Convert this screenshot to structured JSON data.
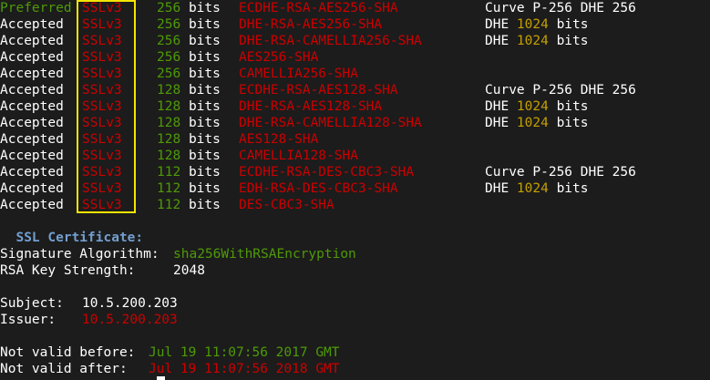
{
  "colors": {
    "background": "#1c1c1c",
    "text": "#ffffff",
    "green": "#4e9a06",
    "red": "#cc0000",
    "yellow": "#c4a000",
    "blue": "#729fcf",
    "highlight_box": "#f5e400"
  },
  "cipher_rows": [
    {
      "status": "Preferred",
      "protocol": "SSLv3",
      "bits": "256",
      "unit": "bits",
      "cipher": "ECDHE-RSA-AES256-SHA",
      "kx_label": "Curve P-256 DHE 256",
      "kx_value": "",
      "kx_unit": ""
    },
    {
      "status": "Accepted",
      "protocol": "SSLv3",
      "bits": "256",
      "unit": "bits",
      "cipher": "DHE-RSA-AES256-SHA",
      "kx_label": "DHE ",
      "kx_value": "1024",
      "kx_unit": " bits"
    },
    {
      "status": "Accepted",
      "protocol": "SSLv3",
      "bits": "256",
      "unit": "bits",
      "cipher": "DHE-RSA-CAMELLIA256-SHA",
      "kx_label": "DHE ",
      "kx_value": "1024",
      "kx_unit": " bits"
    },
    {
      "status": "Accepted",
      "protocol": "SSLv3",
      "bits": "256",
      "unit": "bits",
      "cipher": "AES256-SHA",
      "kx_label": "",
      "kx_value": "",
      "kx_unit": ""
    },
    {
      "status": "Accepted",
      "protocol": "SSLv3",
      "bits": "256",
      "unit": "bits",
      "cipher": "CAMELLIA256-SHA",
      "kx_label": "",
      "kx_value": "",
      "kx_unit": ""
    },
    {
      "status": "Accepted",
      "protocol": "SSLv3",
      "bits": "128",
      "unit": "bits",
      "cipher": "ECDHE-RSA-AES128-SHA",
      "kx_label": "Curve P-256 DHE 256",
      "kx_value": "",
      "kx_unit": ""
    },
    {
      "status": "Accepted",
      "protocol": "SSLv3",
      "bits": "128",
      "unit": "bits",
      "cipher": "DHE-RSA-AES128-SHA",
      "kx_label": "DHE ",
      "kx_value": "1024",
      "kx_unit": " bits"
    },
    {
      "status": "Accepted",
      "protocol": "SSLv3",
      "bits": "128",
      "unit": "bits",
      "cipher": "DHE-RSA-CAMELLIA128-SHA",
      "kx_label": "DHE ",
      "kx_value": "1024",
      "kx_unit": " bits"
    },
    {
      "status": "Accepted",
      "protocol": "SSLv3",
      "bits": "128",
      "unit": "bits",
      "cipher": "AES128-SHA",
      "kx_label": "",
      "kx_value": "",
      "kx_unit": ""
    },
    {
      "status": "Accepted",
      "protocol": "SSLv3",
      "bits": "128",
      "unit": "bits",
      "cipher": "CAMELLIA128-SHA",
      "kx_label": "",
      "kx_value": "",
      "kx_unit": ""
    },
    {
      "status": "Accepted",
      "protocol": "SSLv3",
      "bits": "112",
      "unit": "bits",
      "cipher": "ECDHE-RSA-DES-CBC3-SHA",
      "kx_label": "Curve P-256 DHE 256",
      "kx_value": "",
      "kx_unit": ""
    },
    {
      "status": "Accepted",
      "protocol": "SSLv3",
      "bits": "112",
      "unit": "bits",
      "cipher": "EDH-RSA-DES-CBC3-SHA",
      "kx_label": "DHE ",
      "kx_value": "1024",
      "kx_unit": " bits"
    },
    {
      "status": "Accepted",
      "protocol": "SSLv3",
      "bits": "112",
      "unit": "bits",
      "cipher": "DES-CBC3-SHA",
      "kx_label": "",
      "kx_value": "",
      "kx_unit": ""
    }
  ],
  "certificate": {
    "heading": "  SSL Certificate:",
    "sig_label": "Signature Algorithm: ",
    "sig_value": "sha256WithRSAEncryption",
    "key_label": "RSA Key Strength:    ",
    "key_value": "2048",
    "subject_label": "Subject:  ",
    "subject_value": "10.5.200.203",
    "issuer_label": "Issuer:   ",
    "issuer_value": "10.5.200.203",
    "not_before_label": "Not valid before: ",
    "not_before_value": "Jul 19 11:07:56 2017 GMT",
    "not_after_label": "Not valid after:  ",
    "not_after_value": "Jul 19 11:07:56 2018 GMT"
  }
}
